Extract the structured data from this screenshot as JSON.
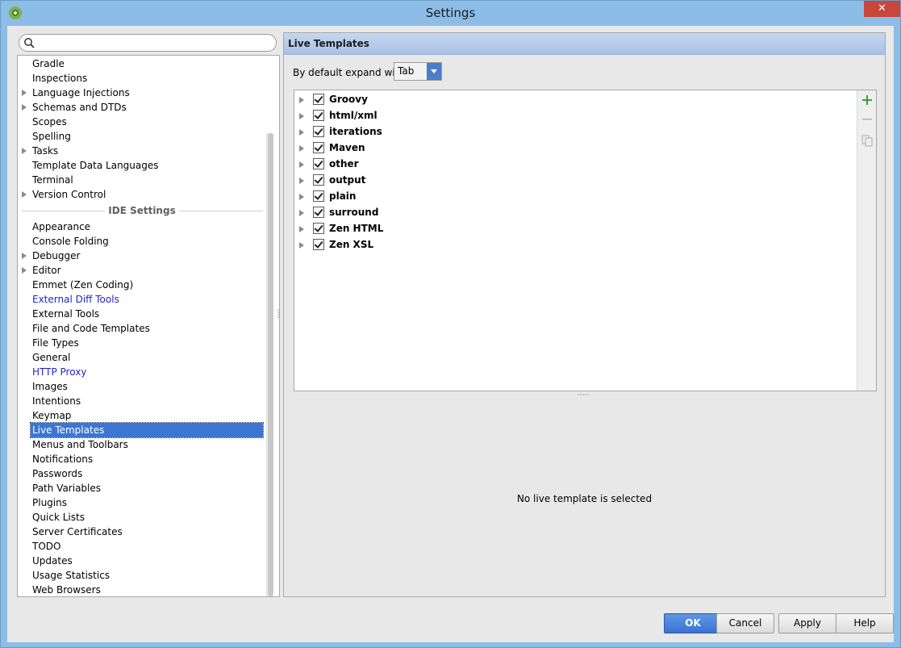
{
  "window": {
    "title": "Settings",
    "close_symbol": "✕"
  },
  "search": {
    "placeholder": "",
    "value": ""
  },
  "sidebar": {
    "project_items": [
      {
        "label": "Gradle",
        "expandable": false
      },
      {
        "label": "Inspections",
        "expandable": false
      },
      {
        "label": "Language Injections",
        "expandable": true
      },
      {
        "label": "Schemas and DTDs",
        "expandable": true
      },
      {
        "label": "Scopes",
        "expandable": false
      },
      {
        "label": "Spelling",
        "expandable": false
      },
      {
        "label": "Tasks",
        "expandable": true
      },
      {
        "label": "Template Data Languages",
        "expandable": false
      },
      {
        "label": "Terminal",
        "expandable": false
      },
      {
        "label": "Version Control",
        "expandable": true
      }
    ],
    "section_header": "IDE Settings",
    "ide_items": [
      {
        "label": "Appearance",
        "expandable": false
      },
      {
        "label": "Console Folding",
        "expandable": false
      },
      {
        "label": "Debugger",
        "expandable": true
      },
      {
        "label": "Editor",
        "expandable": true
      },
      {
        "label": "Emmet (Zen Coding)",
        "expandable": false
      },
      {
        "label": "External Diff Tools",
        "expandable": false,
        "link": true
      },
      {
        "label": "External Tools",
        "expandable": false
      },
      {
        "label": "File and Code Templates",
        "expandable": false
      },
      {
        "label": "File Types",
        "expandable": false
      },
      {
        "label": "General",
        "expandable": false
      },
      {
        "label": "HTTP Proxy",
        "expandable": false,
        "link": true
      },
      {
        "label": "Images",
        "expandable": false
      },
      {
        "label": "Intentions",
        "expandable": false
      },
      {
        "label": "Keymap",
        "expandable": false
      },
      {
        "label": "Live Templates",
        "expandable": false,
        "selected": true
      },
      {
        "label": "Menus and Toolbars",
        "expandable": false
      },
      {
        "label": "Notifications",
        "expandable": false
      },
      {
        "label": "Passwords",
        "expandable": false
      },
      {
        "label": "Path Variables",
        "expandable": false
      },
      {
        "label": "Plugins",
        "expandable": false
      },
      {
        "label": "Quick Lists",
        "expandable": false
      },
      {
        "label": "Server Certificates",
        "expandable": false
      },
      {
        "label": "TODO",
        "expandable": false
      },
      {
        "label": "Updates",
        "expandable": false
      },
      {
        "label": "Usage Statistics",
        "expandable": false
      },
      {
        "label": "Web Browsers",
        "expandable": false
      }
    ]
  },
  "main": {
    "title": "Live Templates",
    "expand_label": "By default expand with",
    "expand_value": "Tab",
    "template_groups": [
      {
        "name": "Groovy",
        "checked": true
      },
      {
        "name": "html/xml",
        "checked": true
      },
      {
        "name": "iterations",
        "checked": true
      },
      {
        "name": "Maven",
        "checked": true
      },
      {
        "name": "other",
        "checked": true
      },
      {
        "name": "output",
        "checked": true
      },
      {
        "name": "plain",
        "checked": true
      },
      {
        "name": "surround",
        "checked": true
      },
      {
        "name": "Zen HTML",
        "checked": true
      },
      {
        "name": "Zen XSL",
        "checked": true
      }
    ],
    "toolbar_icons": [
      "plus-icon",
      "minus-icon",
      "copy-icon"
    ],
    "empty_message": "No live template is selected"
  },
  "buttons": {
    "ok": "OK",
    "cancel": "Cancel",
    "apply": "Apply",
    "help": "Help"
  },
  "colors": {
    "accent": "#3a76d2",
    "link": "#2323c9",
    "add_green": "#3aa03a",
    "close_red": "#c7473a"
  }
}
